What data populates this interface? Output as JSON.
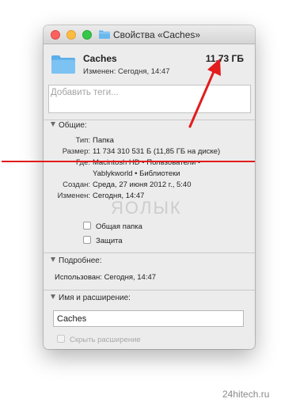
{
  "window": {
    "title": "Свойства «Caches»"
  },
  "header": {
    "name": "Caches",
    "size": "11,73 ГБ",
    "modified": "Изменен: Сегодня, 14:47"
  },
  "tags": {
    "placeholder": "Добавить теги..."
  },
  "general": {
    "title": "Общие:",
    "rows": [
      {
        "label": "Тип:",
        "value": "Папка"
      },
      {
        "label": "Размер:",
        "value": "11 734 310 531 Б (11,85 ГБ на диске)"
      },
      {
        "label": "Где:",
        "value": "Macintosh HD • Пользователи •"
      },
      {
        "label": "",
        "value": "Yablykworld • Библиотеки"
      },
      {
        "label": "Создан:",
        "value": "Среда, 27 июня 2012 г., 5:40"
      },
      {
        "label": "Изменен:",
        "value": "Сегодня, 14:47"
      }
    ],
    "checkboxes": [
      {
        "label": "Общая папка",
        "checked": false
      },
      {
        "label": "Защита",
        "checked": false
      }
    ]
  },
  "more_info": {
    "title": "Подробнее:",
    "last_used": "Использован: Сегодня, 14:47"
  },
  "name_ext": {
    "title": "Имя и расширение:",
    "value": "Caches",
    "hide_ext_label": "Скрыть расширение"
  },
  "watermark": "ЯOЛЫК",
  "site": "24hitech.ru",
  "colors": {
    "folder": "#6ab8ee",
    "annotation": "#e21b1b"
  }
}
